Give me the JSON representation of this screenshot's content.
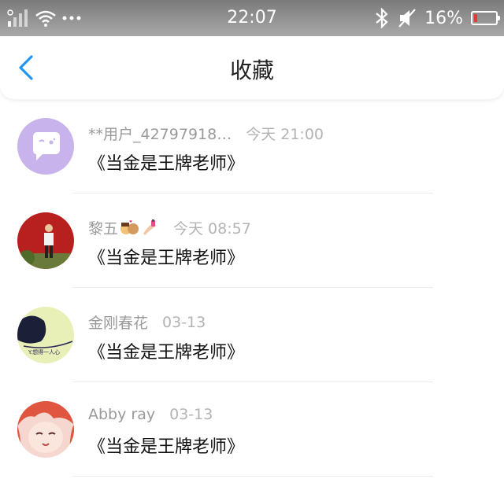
{
  "status_bar": {
    "time": "22:07",
    "battery_text": "16%",
    "battery_level": 0.16,
    "battery_color": "#e53935",
    "icons": [
      "signal-icon",
      "wifi-icon",
      "more-dots-icon",
      "bluetooth-icon",
      "mute-icon",
      "battery-icon"
    ]
  },
  "nav": {
    "title": "收藏",
    "back_icon": "chevron-left-icon",
    "accent": "#2196f3"
  },
  "items": [
    {
      "user": "**用户_42797918…",
      "time": "今天 21:00",
      "title": "《当金是王牌老师》",
      "avatar": "chat-bubble-avatar"
    },
    {
      "user": "黎五",
      "user_emojis": [
        "couple-emoji",
        "nail-polish-emoji"
      ],
      "time": "今天 08:57",
      "title": "《当金是王牌老师》",
      "avatar": "photo-avatar-red"
    },
    {
      "user": "金刚春花",
      "time": "03-13",
      "title": "《当金是王牌老师》",
      "avatar": "photo-avatar-green"
    },
    {
      "user": "Abby ray",
      "time": "03-13",
      "title": "《当金是王牌老师》",
      "avatar": "anime-avatar-pink"
    }
  ]
}
